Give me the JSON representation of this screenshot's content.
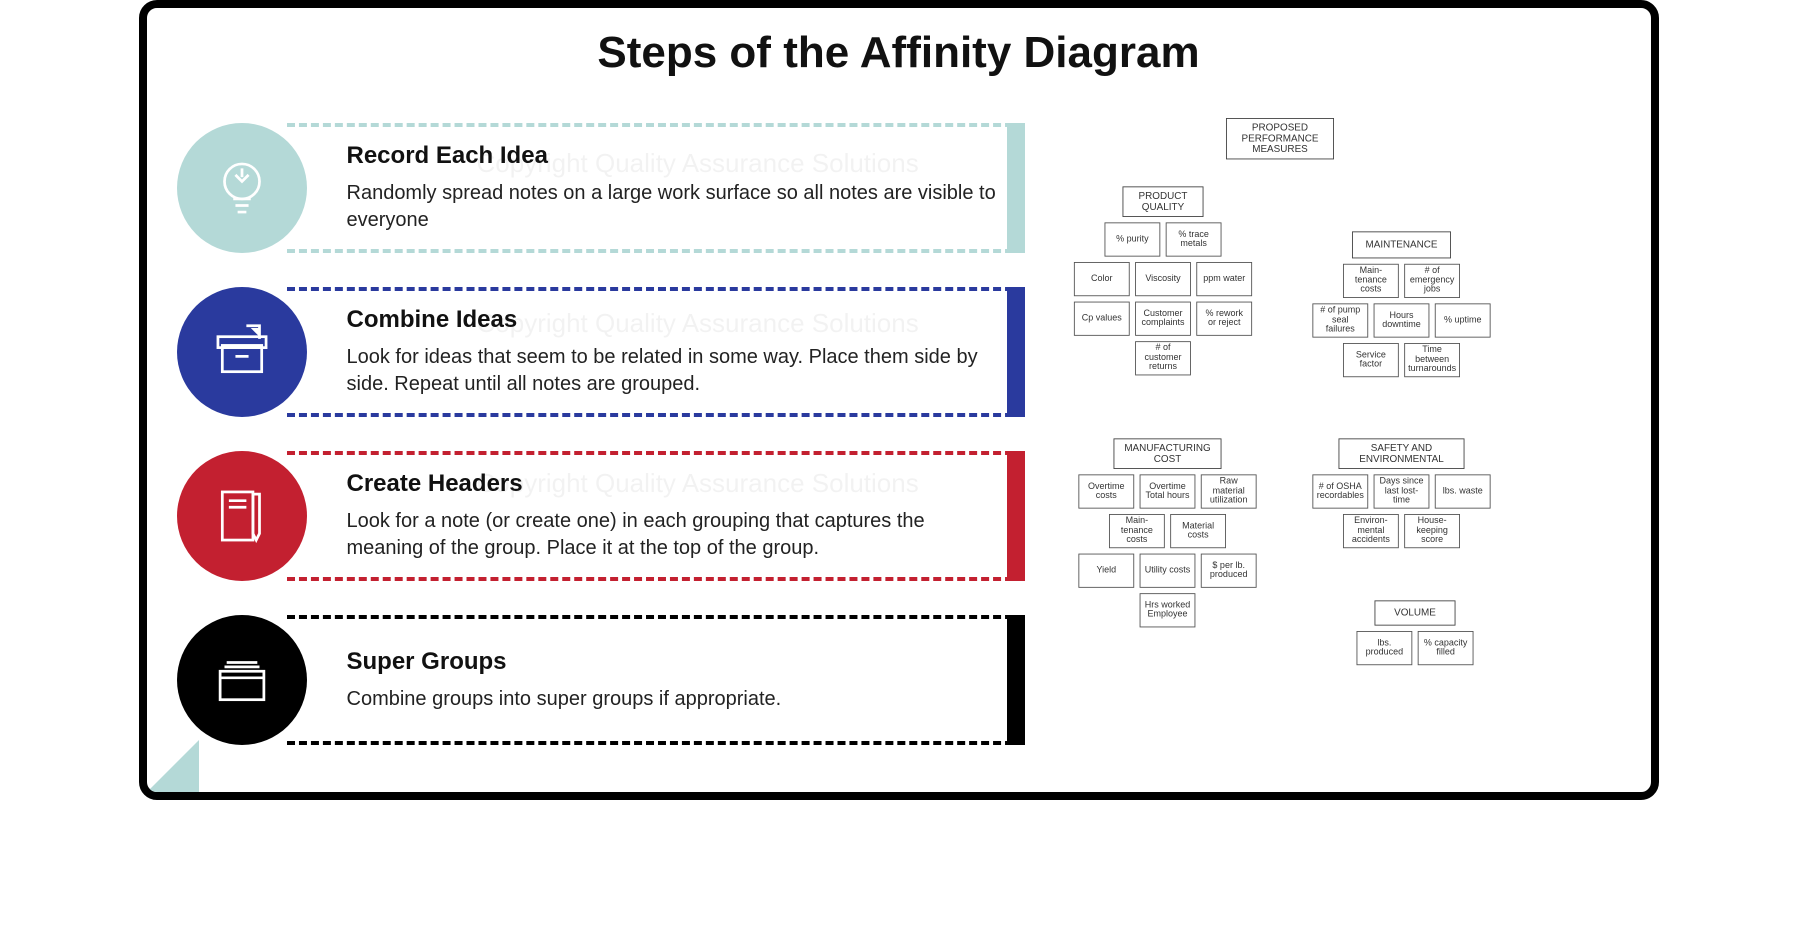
{
  "title": "Steps of the Affinity Diagram",
  "steps": [
    {
      "title": "Record Each Idea",
      "desc": "Randomly spread notes on a large work surface so all notes are visible to everyone",
      "icon": "lightbulb-icon"
    },
    {
      "title": "Combine Ideas",
      "desc": "Look for ideas that seem to be related in some way. Place them side by side. Repeat until all notes are grouped.",
      "icon": "archive-box-icon"
    },
    {
      "title": "Create Headers",
      "desc": "Look for a note (or create one) in each grouping that captures the meaning of the group. Place it at the top of the group.",
      "icon": "notebook-icon"
    },
    {
      "title": "Super Groups",
      "desc": "Combine groups into super groups if appropriate.",
      "icon": "folder-stack-icon"
    }
  ],
  "colors": {
    "step1": "#b4d9d7",
    "step2": "#2a3a9e",
    "step3": "#c32030",
    "step4": "#000000"
  },
  "example": {
    "root": "PROPOSED PERFORMANCE MEASURES",
    "groups": {
      "product_quality": {
        "header": "PRODUCT QUALITY",
        "cells": [
          "% purity",
          "% trace metals",
          "Color",
          "Viscosity",
          "ppm water",
          "Cp values",
          "Customer complaints",
          "% rework or reject",
          "# of customer returns"
        ]
      },
      "maintenance": {
        "header": "MAINTENANCE",
        "cells": [
          "Main-tenance costs",
          "# of emergency jobs",
          "# of pump seal failures",
          "Hours downtime",
          "% uptime",
          "Service factor",
          "Time between turnarounds"
        ]
      },
      "manufacturing_cost": {
        "header": "MANUFACTURING COST",
        "cells": [
          "Overtime costs",
          "Overtime Total hours",
          "Raw material utilization",
          "Main-tenance costs",
          "Material costs",
          "Yield",
          "Utility costs",
          "$ per lb. produced",
          "Hrs worked Employee"
        ]
      },
      "safety_env": {
        "header": "SAFETY AND ENVIRONMENTAL",
        "cells": [
          "# of OSHA recordables",
          "Days since last lost-time",
          "lbs. waste",
          "Environ-mental accidents",
          "House-keeping score"
        ]
      },
      "volume": {
        "header": "VOLUME",
        "cells": [
          "lbs. produced",
          "% capacity filled"
        ]
      }
    }
  },
  "watermark": "Copyright Quality Assurance Solutions"
}
